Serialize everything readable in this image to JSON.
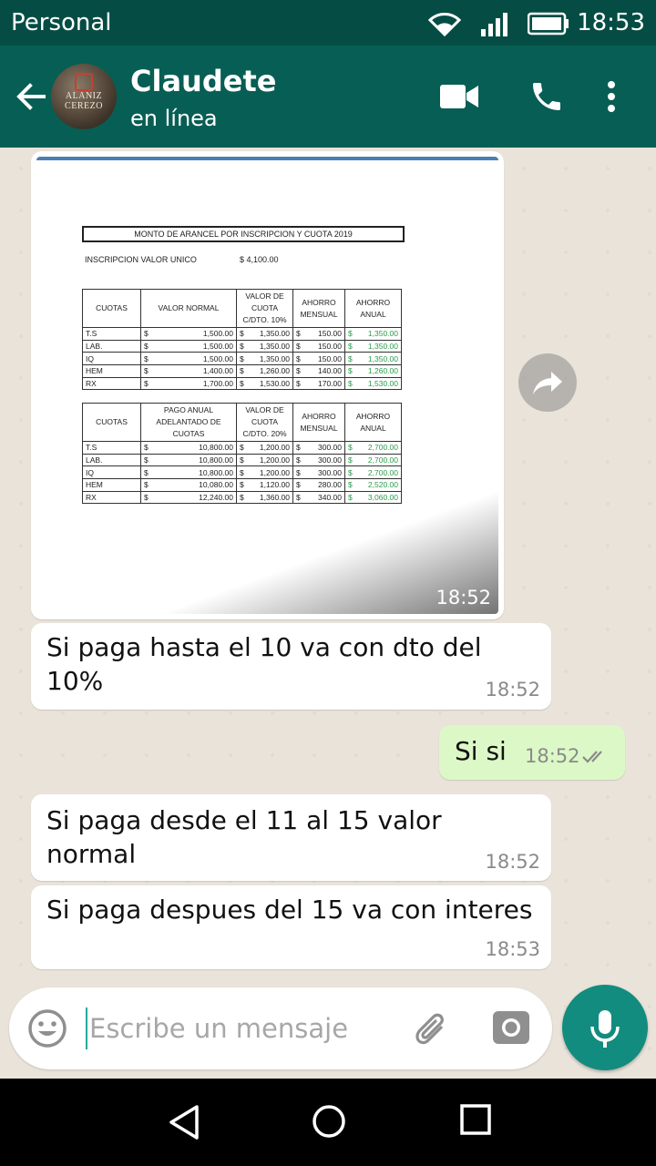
{
  "status_bar": {
    "carrier": "Personal",
    "time": "18:53"
  },
  "header": {
    "contact_name": "Claudete",
    "contact_status": "en línea",
    "avatar_text": "ALANIZ CEREZO"
  },
  "image_message": {
    "time": "18:52",
    "document": {
      "title": "MONTO DE ARANCEL POR INSCRIPCION Y CUOTA 2019",
      "inscripcion_label": "INSCRIPCION VALOR UNICO",
      "inscripcion_value": "$    4,100.00",
      "currency": "$",
      "table1": {
        "headers": [
          "CUOTAS",
          "VALOR NORMAL",
          "VALOR DE CUOTA C/DTO. 10%",
          "AHORRO MENSUAL",
          "AHORRO ANUAL"
        ],
        "rows": [
          [
            "T.S",
            "1,500.00",
            "1,350.00",
            "150.00",
            "1,350.00"
          ],
          [
            "LAB.",
            "1,500.00",
            "1,350.00",
            "150.00",
            "1,350.00"
          ],
          [
            "IQ",
            "1,500.00",
            "1,350.00",
            "150.00",
            "1,350.00"
          ],
          [
            "HEM",
            "1,400.00",
            "1,260.00",
            "140.00",
            "1,260.00"
          ],
          [
            "RX",
            "1,700.00",
            "1,530.00",
            "170.00",
            "1,530.00"
          ]
        ]
      },
      "table2": {
        "headers": [
          "CUOTAS",
          "PAGO ANUAL ADELANTADO DE CUOTAS",
          "VALOR DE CUOTA C/DTO. 20%",
          "AHORRO MENSUAL",
          "AHORRO ANUAL"
        ],
        "rows": [
          [
            "T.S",
            "10,800.00",
            "1,200.00",
            "300.00",
            "2,700.00"
          ],
          [
            "LAB.",
            "10,800.00",
            "1,200.00",
            "300.00",
            "2,700.00"
          ],
          [
            "IQ",
            "10,800.00",
            "1,200.00",
            "300.00",
            "2,700.00"
          ],
          [
            "HEM",
            "10,080.00",
            "1,120.00",
            "280.00",
            "2,520.00"
          ],
          [
            "RX",
            "12,240.00",
            "1,360.00",
            "340.00",
            "3,060.00"
          ]
        ]
      }
    }
  },
  "messages": [
    {
      "text": "Si paga hasta el 10 va con dto del 10%",
      "time": "18:52"
    },
    {
      "text": "Si si",
      "time": "18:52"
    },
    {
      "text": "Si paga desde el 11 al 15 valor normal",
      "time": "18:52"
    },
    {
      "text": "Si paga despues del 15 va con interes",
      "time": "18:53"
    }
  ],
  "input": {
    "placeholder": "Escribe un mensaje"
  },
  "colors": {
    "header": "#075e54",
    "status_bar": "#054d44",
    "outgoing_bubble": "#dcf8c6",
    "accent": "#128c7e",
    "read_ticks": "#8a8a8a"
  }
}
